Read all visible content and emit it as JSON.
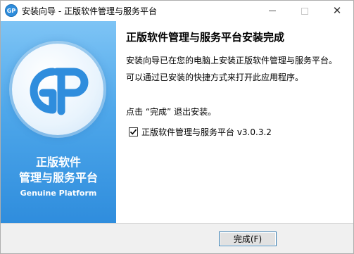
{
  "window": {
    "title": "安装向导 - 正版软件管理与服务平台",
    "app_icon_text": "GP"
  },
  "controls": {
    "minimize": "minimize-icon",
    "maximize": "maximize-icon",
    "close": "close-icon",
    "close_glyph": "✕"
  },
  "banner": {
    "title_line1": "正版软件",
    "title_line2": "管理与服务平台",
    "subtitle": "Genuine Platform",
    "logo_letters": "GP",
    "colors": {
      "top": "#7ec4f5",
      "bottom": "#2f8ddd",
      "logo_stroke": "#2f8ddd"
    }
  },
  "content": {
    "heading": "正版软件管理与服务平台安装完成",
    "line1": "安装向导已在您的电脑上安装正版软件管理与服务平台。",
    "line2": "可以通过已安装的快捷方式来打开此应用程序。",
    "line3": "点击 “完成” 退出安装。",
    "checkbox": {
      "label": "正版软件管理与服务平台 v3.0.3.2",
      "checked": true
    }
  },
  "footer": {
    "finish_label": "完成(F)"
  }
}
